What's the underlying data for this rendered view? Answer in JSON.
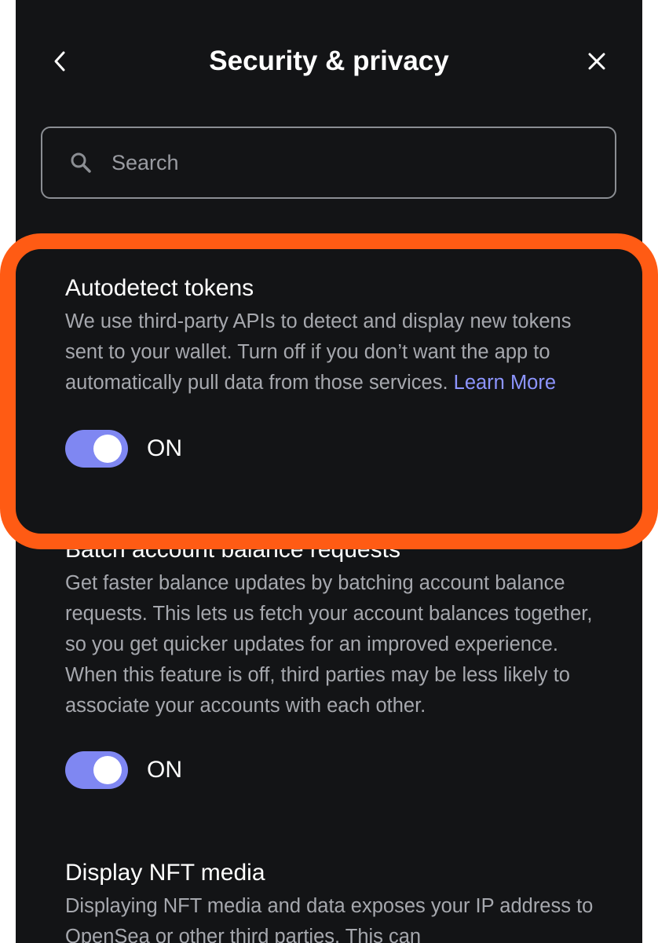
{
  "header": {
    "title": "Security & privacy",
    "back_icon": "chevron-left-icon",
    "close_icon": "close-icon"
  },
  "search": {
    "placeholder": "Search",
    "value": "",
    "icon": "search-icon"
  },
  "settings": [
    {
      "title": "Autodetect tokens",
      "description": "We use third-party APIs to detect and display new tokens sent to your wallet. Turn off if you don’t want the app to automatically pull data from those services. ",
      "link": "Learn More",
      "toggle_state": "ON"
    },
    {
      "title": "Batch account balance requests",
      "description": "Get faster balance updates by batching account balance requests. This lets us fetch your account balances together, so you get quicker updates for an improved experience. When this feature is off, third parties may be less likely to associate your accounts with each other.",
      "toggle_state": "ON"
    },
    {
      "title": "Display NFT media",
      "description": "Displaying NFT media and data exposes your IP address to OpenSea or other third parties. This can"
    }
  ],
  "colors": {
    "background": "#131416",
    "accent": "#7f87f2",
    "link": "#8d95ff",
    "highlight": "#ff5b14"
  }
}
